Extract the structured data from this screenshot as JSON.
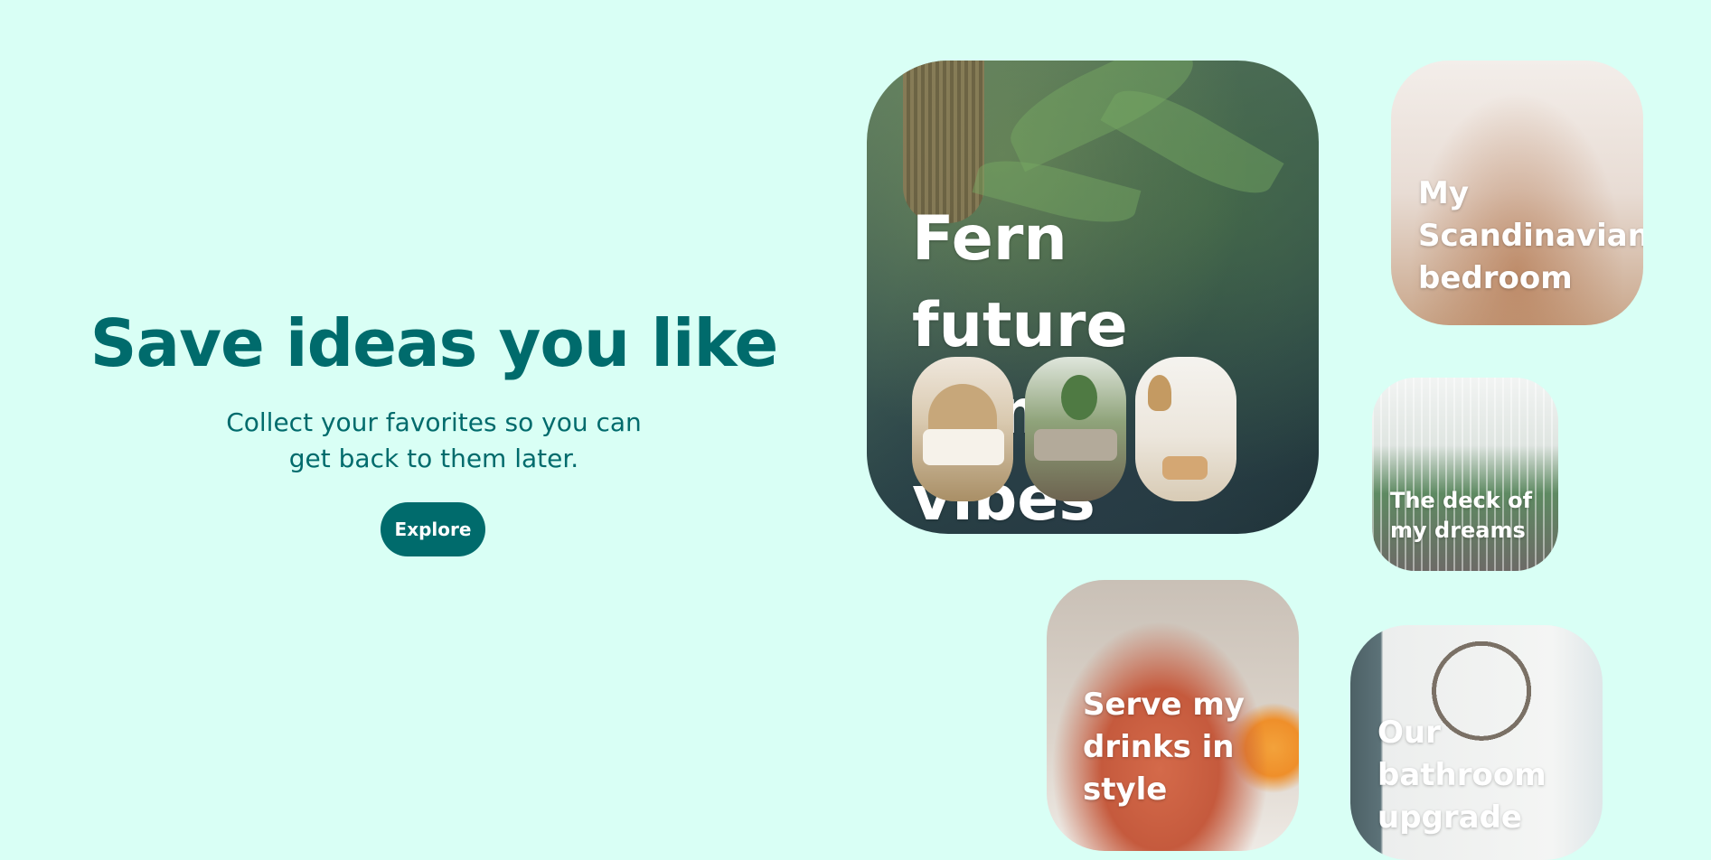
{
  "hero": {
    "title": "Save ideas you like",
    "subtitle": "Collect your favorites so you can get back to them later.",
    "button_label": "Explore"
  },
  "cards": {
    "fern": {
      "title": "Fern future home vibes"
    },
    "scandinavian": {
      "title": "My Scandinavian bedroom"
    },
    "deck": {
      "title": "The deck of my dreams"
    },
    "drinks": {
      "title": "Serve my drinks in style"
    },
    "bathroom": {
      "title": "Our bathroom upgrade"
    }
  },
  "colors": {
    "background": "#d9fff5",
    "accent": "#006b6c",
    "card_text": "#ffffff"
  }
}
